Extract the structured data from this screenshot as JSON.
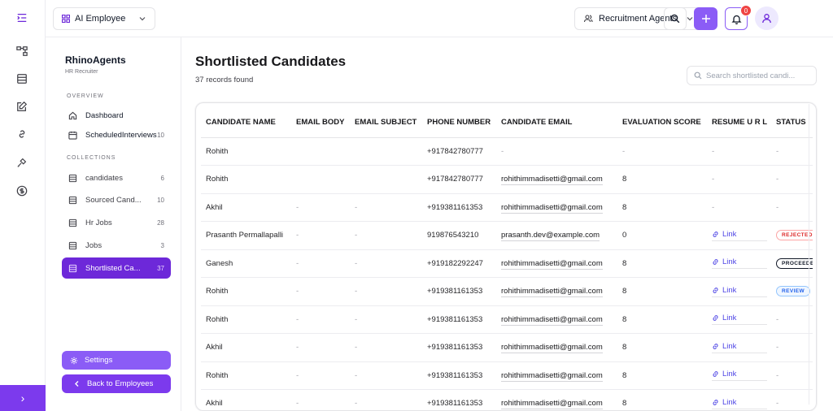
{
  "topbar": {
    "employee_label": "AI Employee",
    "agents_label": "Recruitment Agents",
    "notification_count": "0"
  },
  "sidebar": {
    "brand": "RhinoAgents",
    "brand_sub": "HR Recruiter",
    "overview_label": "OVERVIEW",
    "collections_label": "COLLECTIONS",
    "overview_items": [
      {
        "label": "Dashboard",
        "count": ""
      },
      {
        "label": "ScheduledInterviews",
        "count": "10"
      }
    ],
    "collection_items": [
      {
        "label": "candidates",
        "count": "6"
      },
      {
        "label": "Sourced Cand...",
        "count": "10"
      },
      {
        "label": "Hr Jobs",
        "count": "28"
      },
      {
        "label": "Jobs",
        "count": "3"
      },
      {
        "label": "Shortlisted Ca...",
        "count": "37"
      }
    ],
    "settings_label": "Settings",
    "back_label": "Back to Employees"
  },
  "main": {
    "title": "Shortlisted Candidates",
    "records": "37 records found",
    "search_placeholder": "Search shortlisted candi..."
  },
  "table": {
    "columns": [
      "CANDIDATE NAME",
      "EMAIL BODY",
      "EMAIL SUBJECT",
      "PHONE NUMBER",
      "CANDIDATE EMAIL",
      "EVALUATION SCORE",
      "RESUME U R L",
      "STATUS"
    ],
    "rows": [
      {
        "name": "Rohith",
        "body": "",
        "subject": "",
        "phone": "+917842780777",
        "email": "-",
        "score": "-",
        "resume": "-",
        "status": "-"
      },
      {
        "name": "Rohith",
        "body": "",
        "subject": "",
        "phone": "+917842780777",
        "email": "rohithimmadisetti@gmail.com",
        "score": "8",
        "resume": "-",
        "status": "-"
      },
      {
        "name": "Akhil",
        "body": "-",
        "subject": "-",
        "phone": "+919381161353",
        "email": "rohithimmadisetti@gmail.com",
        "score": "8",
        "resume": "-",
        "status": "-"
      },
      {
        "name": "Prasanth Permallapalli",
        "body": "-",
        "subject": "-",
        "phone": "919876543210",
        "email": "prasanth.dev@example.com",
        "score": "0",
        "resume": "Link",
        "status": "REJECTED"
      },
      {
        "name": "Ganesh",
        "body": "-",
        "subject": "-",
        "phone": "+919182292247",
        "email": "rohithimmadisetti@gmail.com",
        "score": "8",
        "resume": "Link",
        "status": "PROCEEDED"
      },
      {
        "name": "Rohith",
        "body": "-",
        "subject": "-",
        "phone": "+919381161353",
        "email": "rohithimmadisetti@gmail.com",
        "score": "8",
        "resume": "Link",
        "status": "REVIEW"
      },
      {
        "name": "Rohith",
        "body": "-",
        "subject": "-",
        "phone": "+919381161353",
        "email": "rohithimmadisetti@gmail.com",
        "score": "8",
        "resume": "Link",
        "status": "-"
      },
      {
        "name": "Akhil",
        "body": "-",
        "subject": "-",
        "phone": "+919381161353",
        "email": "rohithimmadisetti@gmail.com",
        "score": "8",
        "resume": "Link",
        "status": "-"
      },
      {
        "name": "Rohith",
        "body": "-",
        "subject": "-",
        "phone": "+919381161353",
        "email": "rohithimmadisetti@gmail.com",
        "score": "8",
        "resume": "Link",
        "status": "-"
      },
      {
        "name": "Akhil",
        "body": "-",
        "subject": "-",
        "phone": "+919381161353",
        "email": "rohithimmadisetti@gmail.com",
        "score": "8",
        "resume": "Link",
        "status": "-"
      }
    ]
  },
  "colors": {
    "accent": "#7c3aed",
    "accent_light": "#8b5cf6",
    "badge_rejected": "#dc2626",
    "badge_review": "#2563eb"
  }
}
